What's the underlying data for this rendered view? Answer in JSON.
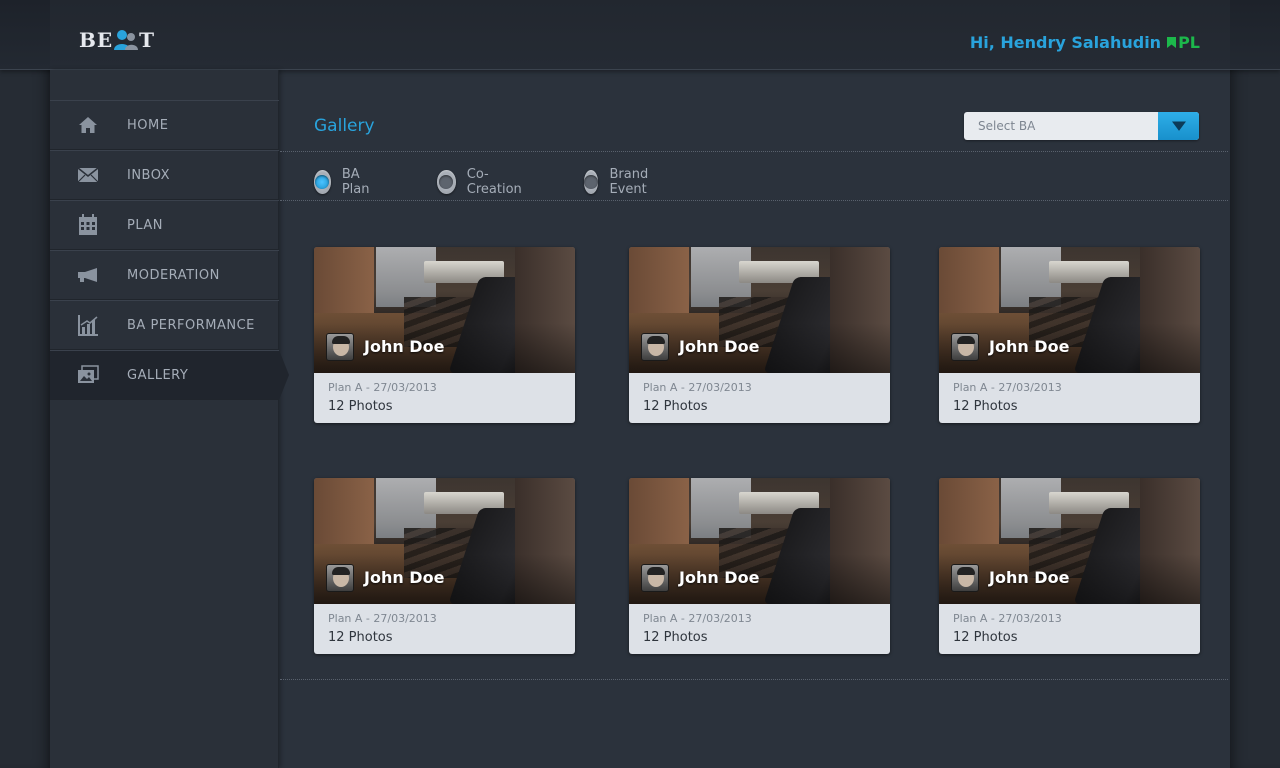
{
  "header": {
    "logo": {
      "prefix": "BE",
      "suffix": "T"
    },
    "greeting": "Hi, Hendry Salahudin",
    "badge": "PL",
    "colors": {
      "accent": "#29a3dc",
      "badge": "#1cb84b"
    }
  },
  "sidebar": {
    "items": [
      {
        "label": "HOME",
        "icon": "home-icon"
      },
      {
        "label": "INBOX",
        "icon": "envelope-icon"
      },
      {
        "label": "PLAN",
        "icon": "calendar-icon"
      },
      {
        "label": "MODERATION",
        "icon": "megaphone-icon"
      },
      {
        "label": "BA PERFORMANCE",
        "icon": "bar-chart-icon"
      },
      {
        "label": "GALLERY",
        "icon": "gallery-icon",
        "active": true
      }
    ]
  },
  "main": {
    "title": "Gallery",
    "select": {
      "placeholder": "Select BA"
    },
    "filters": [
      {
        "label": "BA Plan",
        "checked": true
      },
      {
        "label": "Co-Creation",
        "checked": false
      },
      {
        "label": "Brand Event",
        "checked": false
      }
    ],
    "cards": [
      {
        "name": "John Doe",
        "plan": "Plan A - 27/03/2013",
        "count": "12 Photos"
      },
      {
        "name": "John Doe",
        "plan": "Plan A - 27/03/2013",
        "count": "12 Photos"
      },
      {
        "name": "John Doe",
        "plan": "Plan A - 27/03/2013",
        "count": "12 Photos"
      },
      {
        "name": "John Doe",
        "plan": "Plan A - 27/03/2013",
        "count": "12 Photos"
      },
      {
        "name": "John Doe",
        "plan": "Plan A - 27/03/2013",
        "count": "12 Photos"
      },
      {
        "name": "John Doe",
        "plan": "Plan A - 27/03/2013",
        "count": "12 Photos"
      }
    ]
  }
}
